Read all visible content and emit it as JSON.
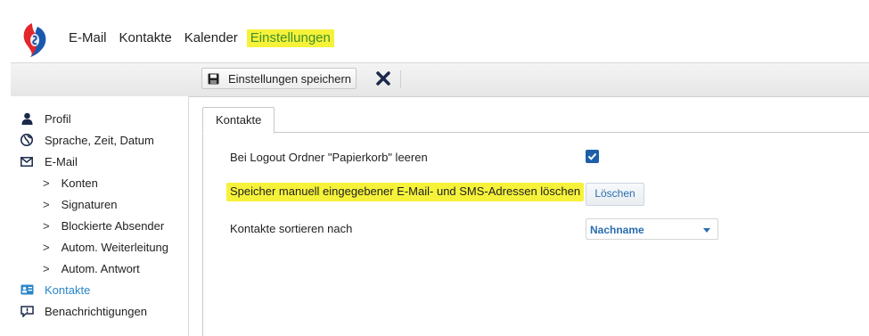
{
  "topnav": {
    "items": [
      {
        "label": "E-Mail"
      },
      {
        "label": "Kontakte"
      },
      {
        "label": "Kalender"
      },
      {
        "label": "Einstellungen"
      }
    ]
  },
  "toolbar": {
    "save_label": "Einstellungen speichern"
  },
  "sidebar": {
    "items": [
      {
        "label": "Profil",
        "icon": "person-icon"
      },
      {
        "label": "Sprache, Zeit, Datum",
        "icon": "globe-icon"
      },
      {
        "label": "E-Mail",
        "icon": "envelope-icon"
      },
      {
        "label": "Konten"
      },
      {
        "label": "Signaturen"
      },
      {
        "label": "Blockierte Absender"
      },
      {
        "label": "Autom. Weiterleitung"
      },
      {
        "label": "Autom. Antwort"
      },
      {
        "label": "Kontakte",
        "icon": "contacts-card-icon"
      },
      {
        "label": "Benachrichtigungen",
        "icon": "notification-icon"
      }
    ]
  },
  "content": {
    "tab_label": "Kontakte",
    "rows": [
      {
        "label": "Bei Logout Ordner \"Papierkorb\" leeren"
      },
      {
        "label": "Speicher manuell eingegebener E-Mail- und SMS-Adressen löschen",
        "button_label": "Löschen"
      },
      {
        "label": "Kontakte sortieren nach",
        "select_value": "Nachname"
      }
    ]
  },
  "colors": {
    "highlight": "#f6f23a",
    "active_nav": "#3f8f2a",
    "accent_blue": "#2a86c8",
    "checkbox": "#1f5fa8"
  }
}
